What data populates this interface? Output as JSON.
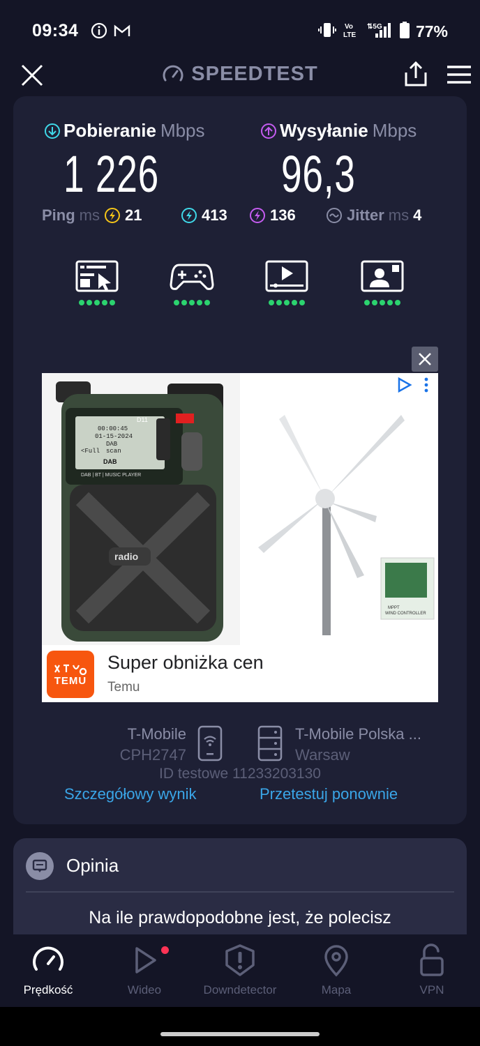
{
  "status_bar": {
    "time": "09:34",
    "battery": "77%",
    "icons": [
      "info-icon",
      "gmail-icon",
      "vibrate-icon",
      "volte-icon",
      "5g-signal-icon",
      "battery-icon"
    ]
  },
  "header": {
    "title": "SPEEDTEST",
    "icons": [
      "close-icon",
      "speedometer-icon",
      "share-icon",
      "menu-icon"
    ]
  },
  "results": {
    "download": {
      "label": "Pobieranie",
      "unit": "Mbps",
      "value": "1 226"
    },
    "upload": {
      "label": "Wysyłanie",
      "unit": "Mbps",
      "value": "96,3"
    },
    "ping": {
      "label": "Ping",
      "unit": "ms",
      "idle": "21",
      "download": "413",
      "upload": "136"
    },
    "jitter": {
      "label": "Jitter",
      "unit": "ms",
      "value": "4"
    }
  },
  "quality": [
    {
      "name": "browsing",
      "icon": "browser-icon",
      "rating": 5
    },
    {
      "name": "gaming",
      "icon": "gamepad-icon",
      "rating": 5
    },
    {
      "name": "video",
      "icon": "video-icon",
      "rating": 5
    },
    {
      "name": "video-call",
      "icon": "video-call-icon",
      "rating": 5
    }
  ],
  "ad": {
    "title": "Super obniżka cen",
    "advertiser": "Temu",
    "logo_text": "TEMU",
    "radio_screen": {
      "model": "D11",
      "time": "00:00:45",
      "date": "01-15-2024",
      "band": "DAB",
      "left": "<Full",
      "right": "scan",
      "footer": "DAB",
      "caption": "DAB | BT | MUSIC PLAYER",
      "speaker": "radio"
    },
    "controller_label": "MPPT\nWIND CONTROLLER",
    "colors": {
      "temu": "#f7560f",
      "adchoices": "#1a73e8"
    }
  },
  "server": {
    "provider": "T-Mobile",
    "device": "CPH2747",
    "name": "T-Mobile Polska ...",
    "city": "Warsaw",
    "test_id": "ID testowe 11233203130",
    "detail_link": "Szczegółowy wynik",
    "retest_link": "Przetestuj ponownie"
  },
  "feedback": {
    "title": "Opinia",
    "question": "Na ile prawdopodobne jest, że polecisz"
  },
  "nav": [
    {
      "label": "Prędkość",
      "icon": "speedometer-icon",
      "active": true
    },
    {
      "label": "Wideo",
      "icon": "play-icon",
      "active": false,
      "badge": true
    },
    {
      "label": "Downdetector",
      "icon": "alert-icon",
      "active": false
    },
    {
      "label": "Mapa",
      "icon": "map-pin-icon",
      "active": false
    },
    {
      "label": "VPN",
      "icon": "lock-icon",
      "active": false
    }
  ],
  "colors": {
    "background": "#141526",
    "card": "#1e2035",
    "accent_link": "#3aa6e8",
    "download": "#3fd8e8",
    "upload": "#c45cf0",
    "ping_idle": "#f5c518",
    "quality_dot": "#2cd36f",
    "badge": "#ff3355"
  }
}
